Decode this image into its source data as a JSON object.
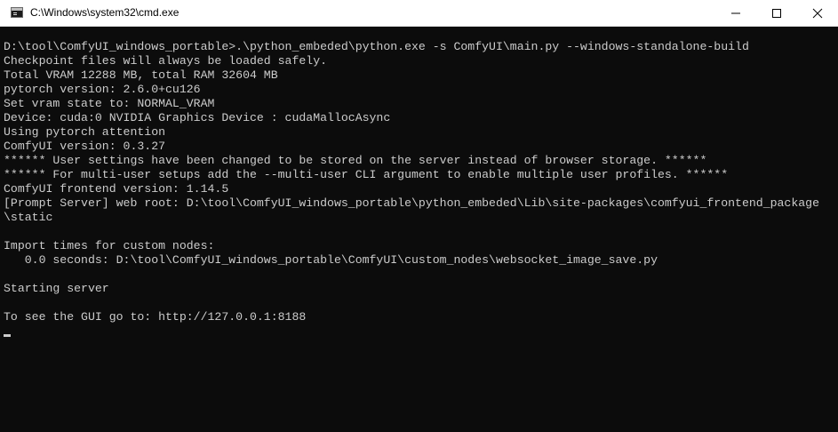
{
  "window": {
    "title": "C:\\Windows\\system32\\cmd.exe",
    "app_icon": "console-icon",
    "controls": {
      "minimize_icon": "minimize-icon",
      "maximize_icon": "maximize-icon",
      "close_icon": "close-icon"
    }
  },
  "colors": {
    "terminal_background": "#0c0c0c",
    "terminal_text": "#cccccc",
    "titlebar_background": "#ffffff"
  },
  "console": {
    "lines": [
      "D:\\tool\\ComfyUI_windows_portable>.\\python_embeded\\python.exe -s ComfyUI\\main.py --windows-standalone-build",
      "Checkpoint files will always be loaded safely.",
      "Total VRAM 12288 MB, total RAM 32604 MB",
      "pytorch version: 2.6.0+cu126",
      "Set vram state to: NORMAL_VRAM",
      "Device: cuda:0 NVIDIA Graphics Device : cudaMallocAsync",
      "Using pytorch attention",
      "ComfyUI version: 0.3.27",
      "****** User settings have been changed to be stored on the server instead of browser storage. ******",
      "****** For multi-user setups add the --multi-user CLI argument to enable multiple user profiles. ******",
      "ComfyUI frontend version: 1.14.5",
      "[Prompt Server] web root: D:\\tool\\ComfyUI_windows_portable\\python_embeded\\Lib\\site-packages\\comfyui_frontend_package",
      "\\static",
      "",
      "Import times for custom nodes:",
      "   0.0 seconds: D:\\tool\\ComfyUI_windows_portable\\ComfyUI\\custom_nodes\\websocket_image_save.py",
      "",
      "Starting server",
      "",
      "To see the GUI go to: http://127.0.0.1:8188"
    ]
  }
}
